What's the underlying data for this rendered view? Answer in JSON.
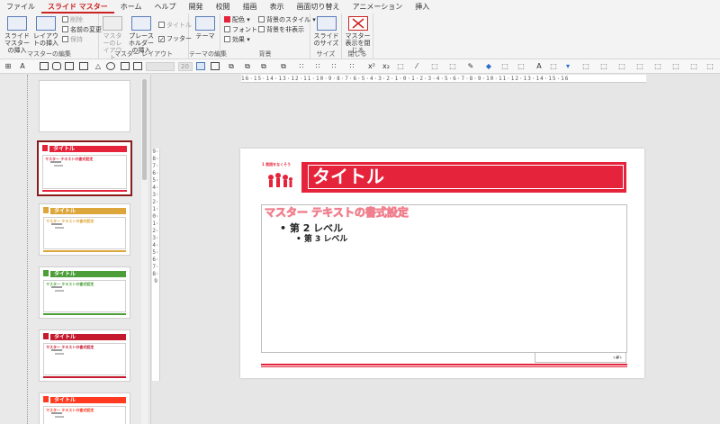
{
  "tabs": [
    "ファイル",
    "スライド マスター",
    "ホーム",
    "ヘルプ",
    "開発",
    "校閲",
    "描画",
    "表示",
    "画面切り替え",
    "アニメーション",
    "挿入"
  ],
  "active_tab_index": 1,
  "ribbon": {
    "groups": [
      {
        "label": "マスターの編集"
      },
      {
        "label": "マスター レイアウト"
      },
      {
        "label": "テーマの編集"
      },
      {
        "label": "背景"
      },
      {
        "label": "サイズ"
      },
      {
        "label": "閉じる"
      }
    ],
    "insert_master": "スライド マスターの挿入",
    "insert_layout": "レイアウトの挿入",
    "delete": "削除",
    "rename": "名前の変更",
    "preserve": "保持",
    "master_layout": "マスターのレイアウト",
    "insert_placeholder": "プレースホルダーの挿入",
    "title_chk": "タイトル",
    "footer_chk": "フッター",
    "theme": "テーマ",
    "colors": "配色",
    "fonts": "フォント",
    "effects": "効果",
    "bg_styles": "背景のスタイル",
    "hide_bg": "背景を非表示",
    "slide_size": "スライドのサイズ",
    "close_master": "マスター表示を閉じる"
  },
  "toolbar": {
    "font_size": "20"
  },
  "ruler": {
    "horizontal": "16·15·14·13·12·11·10·9·8·7·6·5·4·3·2·1·0·1·2·3·4·5·6·7·8·9·10·11·12·13·14·15·16",
    "vertical": "9·8·7·6·5·4·3·2·1·0·1·2·3·4·5·6·7·8·9"
  },
  "thumbnails": [
    {
      "title": "タイトル",
      "body": "マスター テキストの書式設定",
      "color": "#e5243b",
      "selected": true
    },
    {
      "title": "タイトル",
      "body": "マスター テキストの書式設定",
      "color": "#dda63a",
      "selected": false
    },
    {
      "title": "タイトル",
      "body": "マスター テキストの書式設定",
      "color": "#4c9f38",
      "selected": false
    },
    {
      "title": "タイトル",
      "body": "マスター テキストの書式設定",
      "color": "#c5192d",
      "selected": false
    },
    {
      "title": "タイトル",
      "body": "マスター テキストの書式設定",
      "color": "#ff3a21",
      "selected": false
    }
  ],
  "slide": {
    "title": "タイトル",
    "body_level1": "マスター テキストの書式設定",
    "body_level2": "• 第 2 レベル",
    "body_level3": "• 第 3 レベル",
    "page_number": "‹#›",
    "logo_text": "1 貧困をなくそう",
    "accent_color": "#e5243b"
  }
}
